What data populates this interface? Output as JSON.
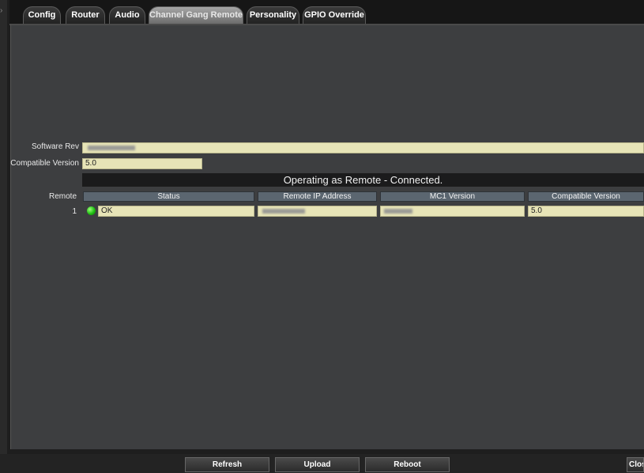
{
  "tabs": [
    {
      "label": "Config"
    },
    {
      "label": "Router"
    },
    {
      "label": "Audio"
    },
    {
      "label": "Channel Gang Remote",
      "active": true
    },
    {
      "label": "Personality"
    },
    {
      "label": "GPIO Override"
    }
  ],
  "fields": {
    "software_rev": {
      "label": "Software Rev",
      "value": ""
    },
    "compatible_version": {
      "label": "Compatible Version",
      "value": "5.0"
    }
  },
  "status_message": "Operating as Remote - Connected.",
  "remote_table": {
    "row_header": "Remote",
    "columns": [
      "Status",
      "Remote IP Address",
      "MC1 Version",
      "Compatible Version"
    ],
    "rows": [
      {
        "remote": "1",
        "status": "OK",
        "ip": "",
        "mc1_version": "",
        "compatible_version": "5.0",
        "led_color": "#1fbf12"
      }
    ]
  },
  "buttons": {
    "refresh": "Refresh",
    "upload": "Upload",
    "reboot": "Reboot",
    "close": "Close"
  }
}
